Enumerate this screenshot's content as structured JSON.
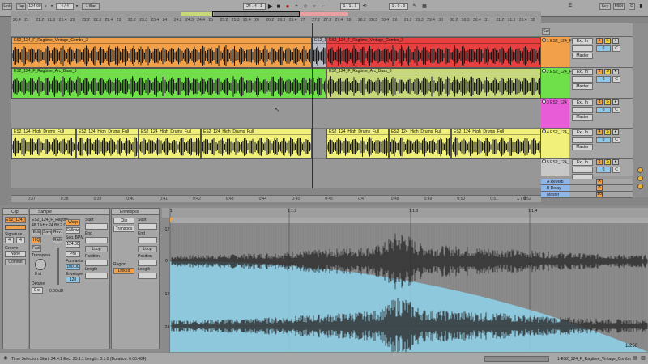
{
  "transport": {
    "link_label": "Link",
    "tap_label": "Tap",
    "tempo": "124.00",
    "meter": "4 / 4",
    "quantize": "1 Bar",
    "arrangement_position": "24 . 4 . 1",
    "loop_start": "1 . 1 . 1",
    "loop_length": "1 . 0 . 0",
    "key_label": "Key",
    "midi_label": "MIDI",
    "cpu_label": "D"
  },
  "ruler": {
    "bars": [
      "20.4",
      "21",
      "21.2",
      "21.3",
      "21.4",
      "22",
      "22.2",
      "22.3",
      "22.4",
      "23",
      "23.2",
      "23.3",
      "23.4",
      "24",
      "24.2",
      "24.3",
      "24.4",
      "25",
      "25.2",
      "25.3",
      "25.4",
      "26",
      "26.2",
      "26.3",
      "26.4",
      "27",
      "27.2",
      "27.3",
      "27.4",
      "28",
      "28.2",
      "28.3",
      "28.4",
      "29",
      "29.2",
      "29.3",
      "29.4",
      "30",
      "30.2",
      "30.3",
      "30.4",
      "31",
      "31.2",
      "31.3",
      "31.4",
      "32"
    ],
    "times": [
      "0:37",
      "0:38",
      "0:39",
      "0:40",
      "0:41",
      "0:42",
      "0:43",
      "0:44",
      "0:45",
      "0:46",
      "0:47",
      "0:48",
      "0:49",
      "0:50",
      "0:51",
      "0:52"
    ],
    "zoom_label": "1 / 8"
  },
  "clips": {
    "combo_a": "ES2_124_F_Ragtime_Vintage_Combo_3",
    "combo_b": "ES2_124",
    "combo_c": "ES2_124_F_Ragtime_Vintage_Combo_3",
    "bass_a": "ES2_124_F_Ragtime_Arc_Bass_3",
    "bass_b": "ES2_124_F_Ragtime_Arc_Bass_3",
    "drums_1": "ES2_124_High_Drums_Full",
    "drums_2": "ES2_124_High_Drums_Full",
    "drums_3": "ES2_124_High_Drums_Full",
    "drums_4": "ES2_124_High_Drums_Full",
    "drums_5": "ES2_124_High_Drums_Full",
    "drums_6": "ES2_124_High_Drums_Full",
    "drums_7": "ES2_124_High_Drums_Full"
  },
  "tracks": [
    {
      "name": "1 ES2_124_F",
      "color": "#f2a04a",
      "input": "Ext. In",
      "num": "1",
      "output": "Master"
    },
    {
      "name": "2 ES2_124_F",
      "color": "#6fe04a",
      "input": "Ext. In",
      "num": "2",
      "output": "Master"
    },
    {
      "name": "3 ES2_124_",
      "color": "#e85cd8",
      "input": "Ext. In",
      "num": "3",
      "output": "Master"
    },
    {
      "name": "4 ES2_124_",
      "color": "#f0f07a",
      "input": "Ext. In",
      "num": "4",
      "output": "Master"
    },
    {
      "name": "5 ES2_124_",
      "color": "#c8c8c8",
      "input": "Ext. In",
      "num": "5",
      "output": ""
    }
  ],
  "returns": [
    {
      "name": "A Reverb",
      "num": "A"
    },
    {
      "name": "B Delay",
      "num": "B"
    },
    {
      "name": "Master",
      "num": "1/2"
    }
  ],
  "clip_panel": {
    "title": "Clip",
    "clip_name": "ES2_124_F",
    "signature_label": "Signature",
    "sig_num": "4",
    "sig_den": "4",
    "groove_label": "Groove",
    "groove_value": "None",
    "commit_label": "Commit"
  },
  "sample_panel": {
    "title": "Sample",
    "file_name": "ES2_124_F_Ragtim",
    "file_info": "48.1 kHz 24 Bit 2 Ch",
    "edit_label": "Edit",
    "save_label": "Save",
    "rev_label": "Rev.",
    "warp_label": "Warp",
    "follower_label": "Follower",
    "seg_bpm_label": "Seg. BPM",
    "seg_bpm_value": "124.00",
    "hiq_label": "HiQ",
    "fade_label": "Fade",
    "ram_label": "RAM",
    "transpose_label": "Transpose",
    "transpose_value": "0 st",
    "detune_label": "Detune",
    "detune_value": "0 ct",
    "gain_value": "0.00 dB",
    "start_label": "Start",
    "end_label": "End",
    "loop_label": "Loop",
    "position_label": "Position",
    "length_label": "Length",
    "pro_label": "Pro",
    "formants_label": "Formants",
    "formants_value": "100.00",
    "envelope_label": "Envelope",
    "envelope_value": "128"
  },
  "envelopes_panel": {
    "title": "Envelopes",
    "source": "Clip",
    "control": "Transpos",
    "start_label": "Start",
    "end_label": "End",
    "loop_label": "Loop",
    "position_label": "Position",
    "length_label": "Length",
    "region_label": "Region",
    "linked_label": "Linked"
  },
  "sample_editor": {
    "bar_markers": [
      "1",
      "1.1.2",
      "1.1.3",
      "1.1.4"
    ],
    "db_labels": [
      "-12",
      "0",
      "-12",
      "-24"
    ],
    "zoom": "1/256"
  },
  "status": {
    "selection": "Time Selection: Start: 24.4.1 End: 25.1.1 Length: 0.1.0 (Duration: 0:00.484)",
    "track_clip": "1-ES2_124_F_Ragtime_Vintage_Combo"
  },
  "colors": {
    "orange": "#f2a04a",
    "red": "#e84040",
    "green": "#6fe04a",
    "olive": "#c6d87a",
    "yellow": "#f0f07a",
    "pink": "#e85cd8",
    "envelope": "#8fd2ea"
  }
}
